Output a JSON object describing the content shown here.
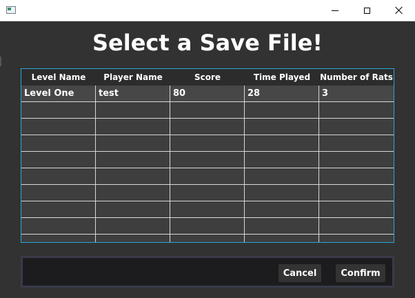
{
  "dialog": {
    "heading": "Select a Save File!"
  },
  "table": {
    "columns": [
      "Level Name",
      "Player Name",
      "Score",
      "Time Played",
      "Number of Rats"
    ],
    "rows": [
      [
        "Level One",
        "test",
        "80",
        "28",
        "3"
      ]
    ]
  },
  "actions": {
    "cancel_label": "Cancel",
    "confirm_label": "Confirm"
  },
  "colors": {
    "background": "#323232",
    "table_border": "#2aa7d6",
    "button": "#333333"
  },
  "icons": {
    "app": "app-window-icon",
    "minimize": "minimize-icon",
    "maximize": "maximize-icon",
    "close": "close-icon"
  }
}
